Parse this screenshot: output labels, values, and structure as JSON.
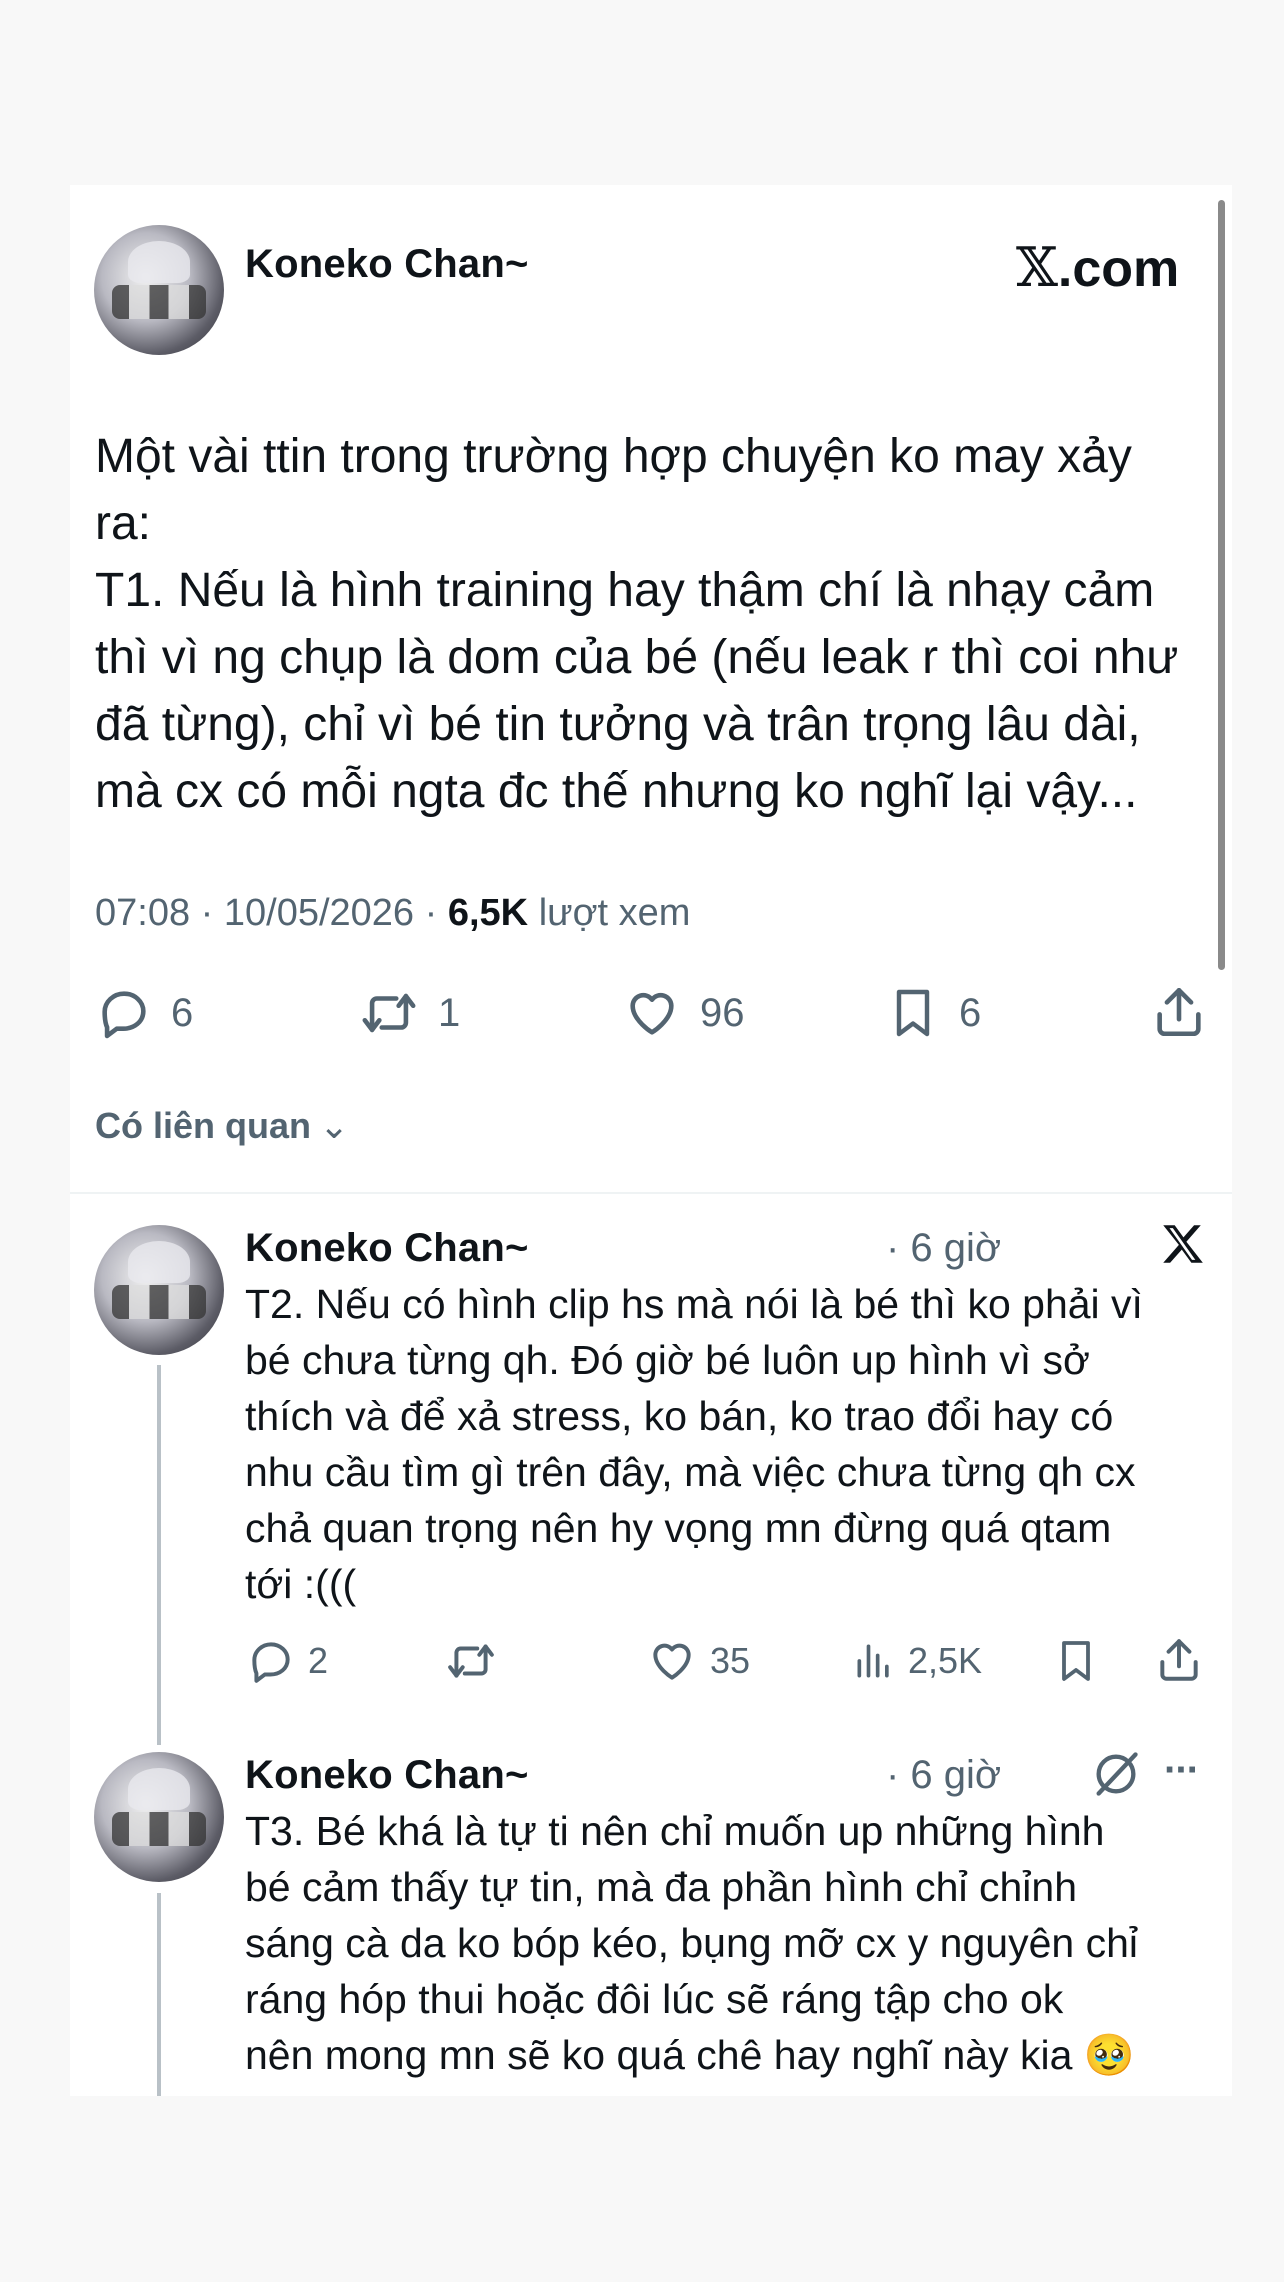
{
  "main_post": {
    "author": "Koneko Chan~",
    "site": ".com",
    "text": "Một vài ttin trong trường hợp chuyện ko may xảy\nra:\nT1. Nếu là hình training hay thậm chí là nhạy cảm\nthì vì ng chụp là dom của bé (nếu leak r thì coi như\nđã từng), chỉ vì bé tin tưởng và trân trọng lâu dài,\nmà cx có mỗi ngta đc thế nhưng ko nghĩ lại vậy...",
    "time": "07:08",
    "date": "10/05/2026",
    "views": "6,5K",
    "views_label": "lượt xem",
    "replies": "6",
    "reposts": "1",
    "likes": "96",
    "bookmarks": "6",
    "related_label": "Có liên quan"
  },
  "replies": [
    {
      "author": "Koneko Chan~",
      "time": "· 6 giờ",
      "text": "T2. Nếu có hình clip hs mà nói là bé thì ko phải vì\nbé chưa từng qh. Đó giờ bé luôn up hình vì sở\nthích và để xả stress, ko bán, ko trao đổi hay có\nnhu cầu tìm gì trên đây, mà việc chưa từng qh cx\nchả quan trọng nên hy vọng mn đừng quá qtam\ntới :(((",
      "comments": "2",
      "likes": "35",
      "views": "2,5K"
    },
    {
      "author": "Koneko Chan~",
      "time": "· 6 giờ",
      "more": "···",
      "text": "T3. Bé khá là tự ti nên chỉ muốn up những hình\nbé cảm thấy tự tin, mà đa phần hình chỉ chỉnh\nsáng cà da ko bóp kéo, bụng mỡ cx y nguyên chỉ\nráng hóp thui hoặc đôi lúc sẽ ráng tập cho ok\nnên mong mn sẽ ko quá chê hay nghĩ này kia 🥹"
    }
  ],
  "colors": {
    "text": "#0f1419",
    "secondary": "#536471",
    "thread_line": "#b9c1c7"
  }
}
